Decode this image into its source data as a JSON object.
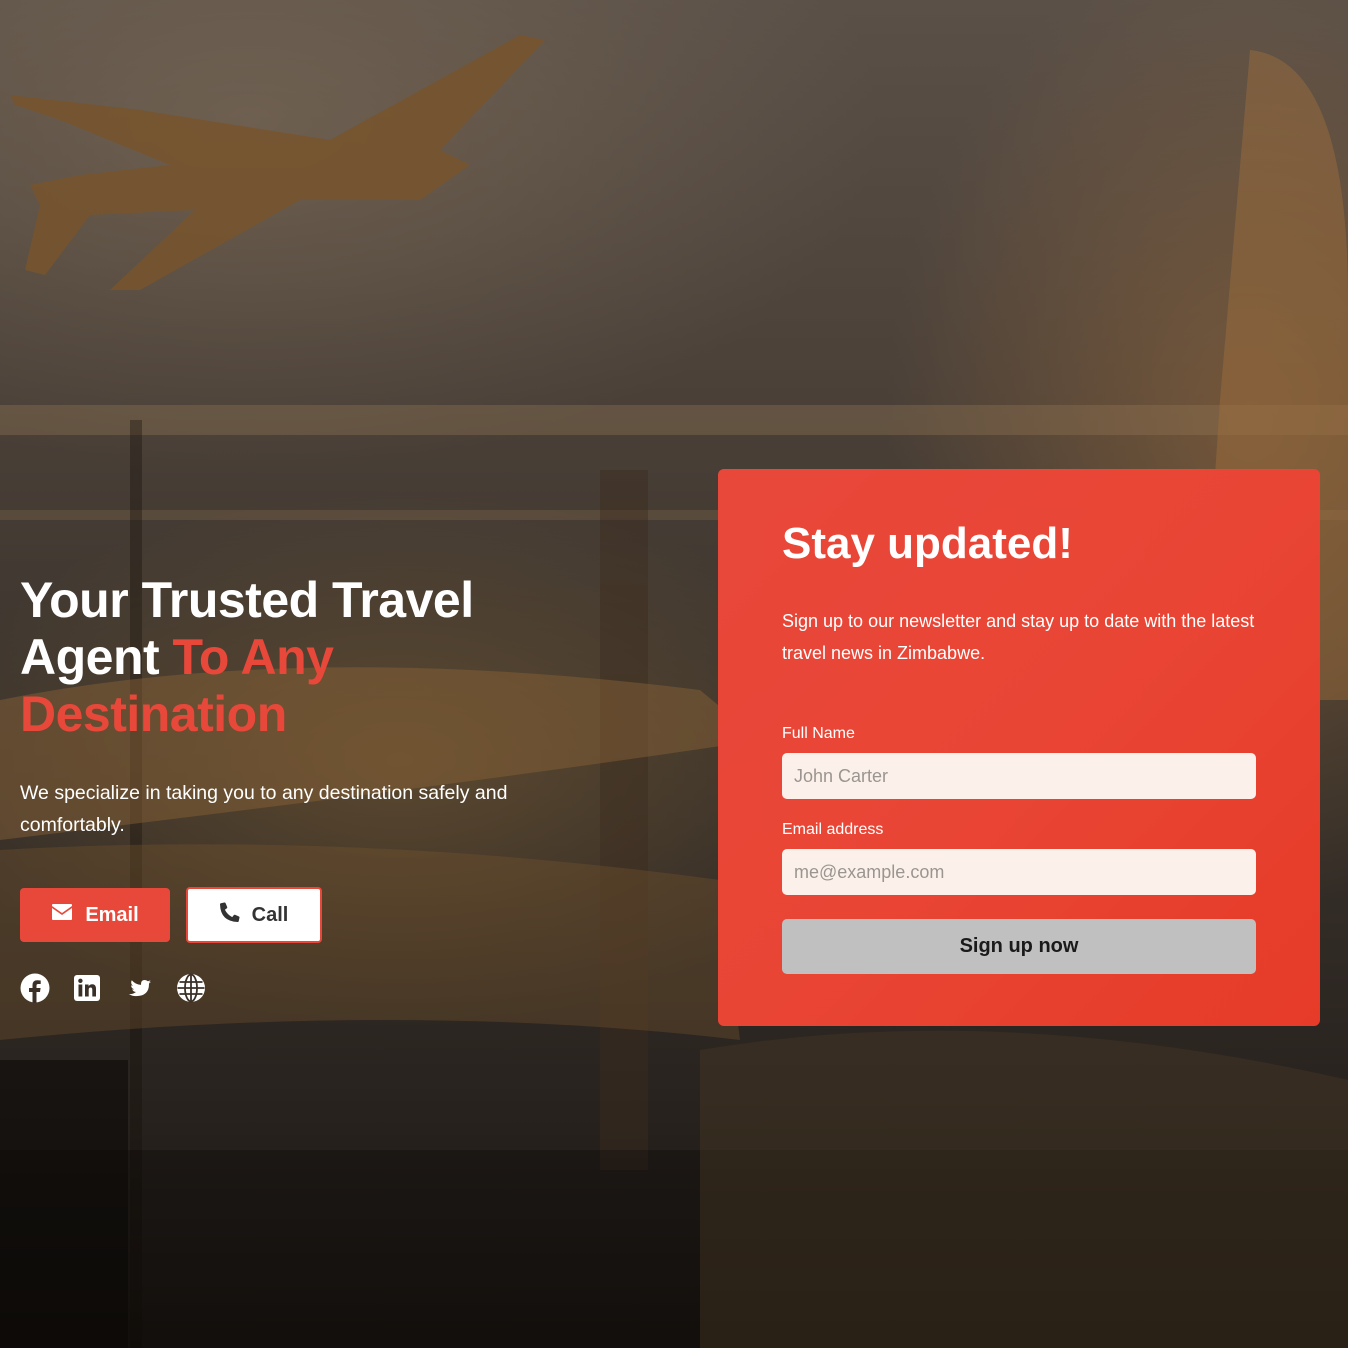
{
  "hero": {
    "headline_line1": "Your Trusted Travel",
    "headline_line2_start": "Agent ",
    "headline_accent": "To Any Destination",
    "subtitle": "We specialize in taking you to any destination safely and comfortably.",
    "email_button": "Email",
    "call_button": "Call",
    "accent_color": "#e8483a"
  },
  "socials": [
    "facebook-icon",
    "linkedin-icon",
    "twitter-icon",
    "globe-icon"
  ],
  "signup": {
    "title": "Stay updated!",
    "description": "Sign up to our newsletter and stay up to date with the latest travel news in Zimbabwe.",
    "name_label": "Full Name",
    "name_placeholder": "John Carter",
    "email_label": "Email address",
    "email_placeholder": "me@example.com",
    "submit_label": "Sign up now",
    "card_color": "#e8483a",
    "button_color": "#c0c0c0"
  }
}
